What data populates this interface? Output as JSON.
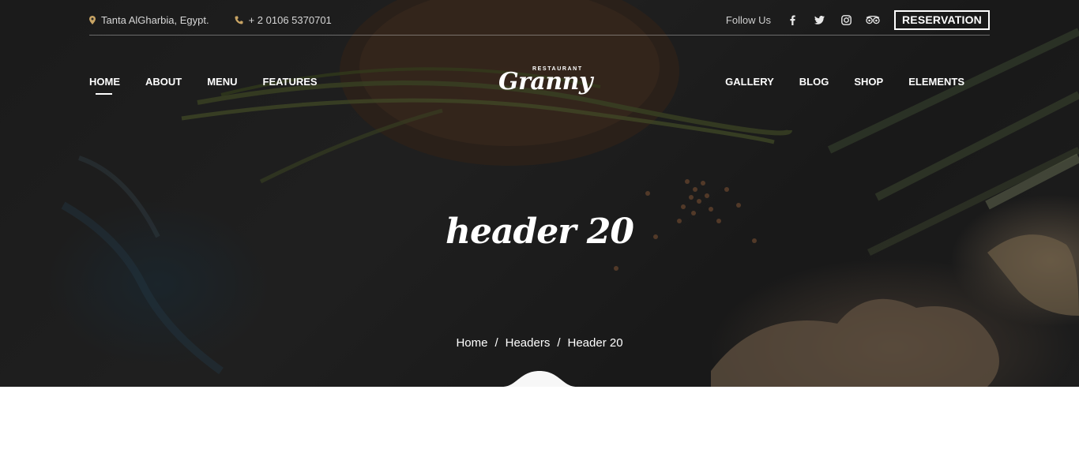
{
  "topbar": {
    "address": "Tanta AlGharbia, Egypt.",
    "phone": "+ 2 0106 5370701",
    "follow_label": "Follow Us",
    "social_icons": [
      "facebook-icon",
      "twitter-icon",
      "instagram-icon",
      "tripadvisor-icon"
    ],
    "reservation_label": "RESERVATION"
  },
  "nav": {
    "left": [
      "HOME",
      "ABOUT",
      "MENU",
      "FEATURES"
    ],
    "right": [
      "GALLERY",
      "BLOG",
      "SHOP",
      "ELEMENTS"
    ],
    "active": "HOME"
  },
  "logo": {
    "small": "RESTAURANT",
    "main": "Granny"
  },
  "hero": {
    "title": "header 20"
  },
  "breadcrumb": [
    "Home",
    "Headers",
    "Header 20"
  ],
  "colors": {
    "accent": "#c8a464",
    "text": "#ffffff",
    "overlay": "#222222"
  }
}
